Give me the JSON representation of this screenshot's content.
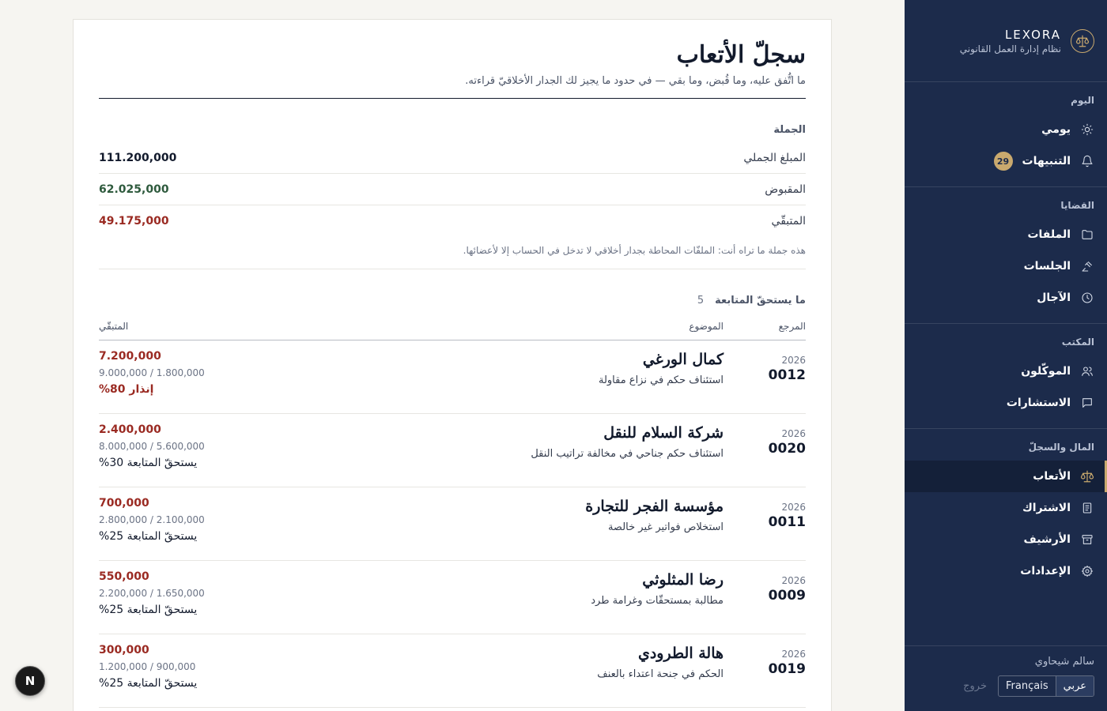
{
  "brand": {
    "name": "LEXORA",
    "subtitle": "نظام إدارة العمل القانوني"
  },
  "nav": {
    "today": {
      "title": "اليوم",
      "items": [
        {
          "label": "يومي",
          "icon": "sun-icon"
        },
        {
          "label": "التنبيهات",
          "icon": "bell-icon",
          "badge": "29"
        }
      ]
    },
    "cases": {
      "title": "القضايا",
      "items": [
        {
          "label": "الملفات",
          "icon": "folder-icon"
        },
        {
          "label": "الجلسات",
          "icon": "gavel-icon"
        },
        {
          "label": "الآجال",
          "icon": "clock-icon"
        }
      ]
    },
    "office": {
      "title": "المكتب",
      "items": [
        {
          "label": "الموكّلون",
          "icon": "users-icon"
        },
        {
          "label": "الاستشارات",
          "icon": "chat-icon"
        }
      ]
    },
    "finance": {
      "title": "المال والسجلّ",
      "items": [
        {
          "label": "الأتعاب",
          "icon": "scales-icon"
        },
        {
          "label": "الاشتراك",
          "icon": "receipt-icon"
        },
        {
          "label": "الأرشيف",
          "icon": "archive-icon"
        },
        {
          "label": "الإعدادات",
          "icon": "gear-icon"
        }
      ]
    }
  },
  "footer": {
    "user": "سالم شيحاوي",
    "lang_ar": "عربي",
    "lang_fr": "Français",
    "logout": "خروج"
  },
  "page": {
    "title": "سجلّ الأتعاب",
    "subtitle": "ما اتُّفق عليه، وما قُبض، وما بقي — في حدود ما يجيز لك الجدار الأخلاقيّ قراءته."
  },
  "summary": {
    "title": "الجملة",
    "total_label": "المبلغ الجملي",
    "total": "111.200,000",
    "paid_label": "المقبوض",
    "paid": "62.025,000",
    "due_label": "المتبقّي",
    "due": "49.175,000",
    "note": "هذه جملة ما تراه أنت: الملفّات المحاطة بجدار أخلاقي لا تدخل في الحساب إلا لأعضائها."
  },
  "followup": {
    "title": "ما يستحقّ المتابعة",
    "count": "5",
    "headers": {
      "ref": "المرجع",
      "subject": "الموضوع",
      "due": "المتبقّي"
    },
    "rows": [
      {
        "year": "2026",
        "num": "0012",
        "client": "كمال الورغي",
        "subject": "استئناف حكم في نزاع مقاولة",
        "due": "7.200,000",
        "ratio": "9.000,000 / 1.800,000",
        "status": "إنذار 80%",
        "warn": true
      },
      {
        "year": "2026",
        "num": "0020",
        "client": "شركة السلام للنقل",
        "subject": "استئناف حكم جناحي في مخالفة تراتيب النقل",
        "due": "2.400,000",
        "ratio": "8.000,000 / 5.600,000",
        "status": "يستحقّ المتابعة 30%",
        "warn": false
      },
      {
        "year": "2026",
        "num": "0011",
        "client": "مؤسسة الفجر للتجارة",
        "subject": "استخلاص فواتير غير خالصة",
        "due": "700,000",
        "ratio": "2.800,000 / 2.100,000",
        "status": "يستحقّ المتابعة 25%",
        "warn": false
      },
      {
        "year": "2026",
        "num": "0009",
        "client": "رضا المثلوثي",
        "subject": "مطالبة بمستحقّات وغرامة طرد",
        "due": "550,000",
        "ratio": "2.200,000 / 1.650,000",
        "status": "يستحقّ المتابعة 25%",
        "warn": false
      },
      {
        "year": "2026",
        "num": "0019",
        "client": "هالة الطرودي",
        "subject": "الحكم في جنحة اعتداء بالعنف",
        "due": "300,000",
        "ratio": "1.200,000 / 900,000",
        "status": "يستحقّ المتابعة 25%",
        "warn": false
      }
    ]
  },
  "fab": {
    "label": "N"
  },
  "colors": {
    "sidebar": "#1c2b4b",
    "accent": "#c9a96e",
    "paid": "#2e5a3d",
    "due": "#9a2a22"
  }
}
